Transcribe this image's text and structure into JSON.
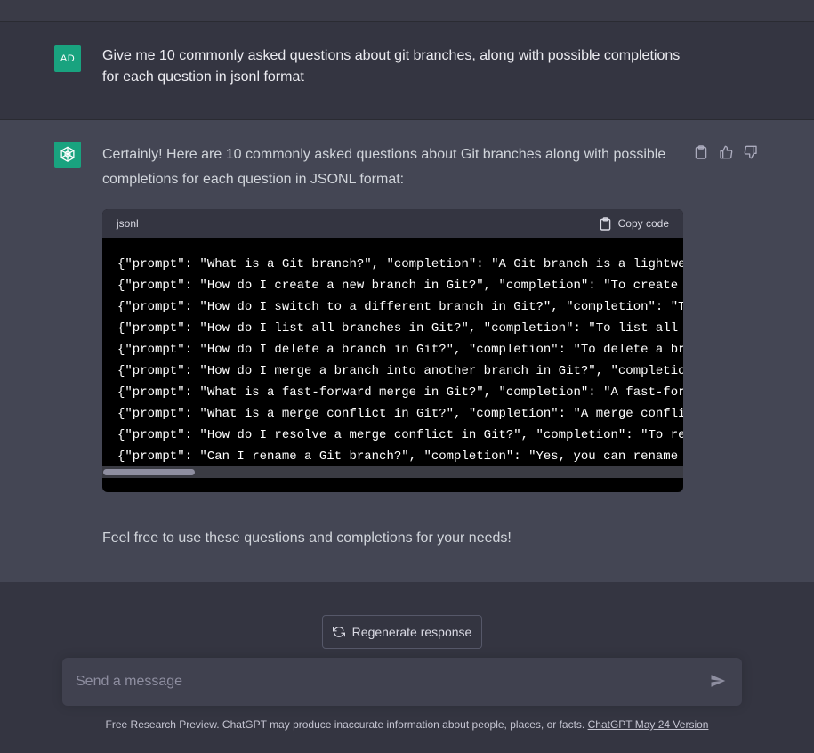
{
  "user_message": {
    "avatar_initials": "AD",
    "text": "Give me 10 commonly asked questions about git branches, along with possible completions for each question in jsonl format"
  },
  "assistant_message": {
    "intro": "Certainly! Here are 10 commonly asked questions about Git branches along with possible completions for each question in JSONL format:",
    "code_block": {
      "language": "jsonl",
      "copy_label": "Copy code",
      "lines": [
        "{\"prompt\": \"What is a Git branch?\", \"completion\": \"A Git branch is a lightwe",
        "{\"prompt\": \"How do I create a new branch in Git?\", \"completion\": \"To create ",
        "{\"prompt\": \"How do I switch to a different branch in Git?\", \"completion\": \"T",
        "{\"prompt\": \"How do I list all branches in Git?\", \"completion\": \"To list all ",
        "{\"prompt\": \"How do I delete a branch in Git?\", \"completion\": \"To delete a br",
        "{\"prompt\": \"How do I merge a branch into another branch in Git?\", \"completio",
        "{\"prompt\": \"What is a fast-forward merge in Git?\", \"completion\": \"A fast-for",
        "{\"prompt\": \"What is a merge conflict in Git?\", \"completion\": \"A merge confli",
        "{\"prompt\": \"How do I resolve a merge conflict in Git?\", \"completion\": \"To re",
        "{\"prompt\": \"Can I rename a Git branch?\", \"completion\": \"Yes, you can rename "
      ]
    },
    "outro": "Feel free to use these questions and completions for your needs!",
    "actions": [
      "clipboard-icon",
      "thumbs-up-icon",
      "thumbs-down-icon"
    ]
  },
  "regenerate_label": "Regenerate response",
  "composer": {
    "placeholder": "Send a message"
  },
  "footer": {
    "text": "Free Research Preview. ChatGPT may produce inaccurate information about people, places, or facts. ",
    "link": "ChatGPT May 24 Version"
  },
  "colors": {
    "background": "#343541",
    "assistant_background": "#444654",
    "avatar": "#19a37f",
    "code_background": "#000000"
  }
}
